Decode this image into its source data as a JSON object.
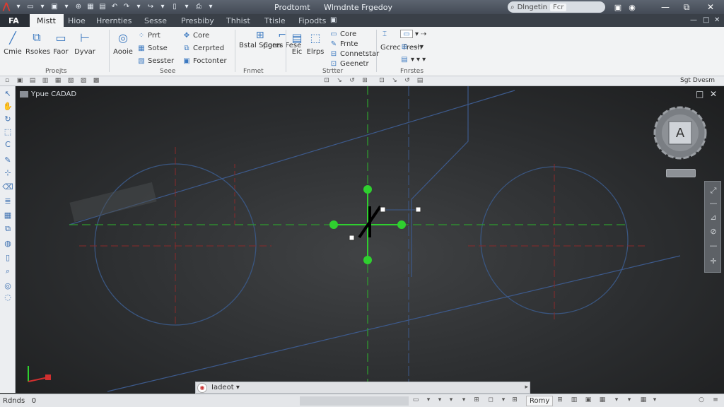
{
  "app": {
    "title_left": "Prodtomt",
    "title_right": "Wlmdnte Frgedoy",
    "search_value": "Dlngetin",
    "search_box": "Fcr"
  },
  "menu": {
    "file": "FA",
    "tabs": [
      "Mistt",
      "Hioe",
      "Hrernties",
      "Sesse",
      "Presbiby",
      "Thhist",
      "Ttisle",
      "Fipodts"
    ]
  },
  "ribbon": {
    "large_buttons": [
      {
        "label": "Cmie"
      },
      {
        "label": "Rsokes"
      },
      {
        "label": "Faor"
      },
      {
        "label": "Dyvar"
      },
      {
        "label": "Aooie"
      },
      {
        "label": "Eic"
      },
      {
        "label": "Elrps"
      }
    ],
    "small_buttons": {
      "draw": [
        "Prrt",
        "Sotse",
        "Sesster"
      ],
      "modify": [
        "Core",
        "Cerprted",
        "Foctonter"
      ],
      "format": [
        "Bstal Spgen",
        "Cores Fese"
      ],
      "insert": [
        "Core",
        "Frnte",
        "Connetstar",
        "Geenetr"
      ],
      "layers": [
        "Gcrec Fresh"
      ]
    },
    "panel_titles": [
      "Proejts",
      "Seee",
      "Fnmet",
      "Strtter",
      "Fnrstes"
    ]
  },
  "subbar": {
    "right_label": "Sgt Dvesm"
  },
  "canvas": {
    "title": "Ypue CADAD"
  },
  "viewcube": {
    "face": "A"
  },
  "command": {
    "text": "Iadeot",
    "dropdown": "▾"
  },
  "status": {
    "left": "Rdnds",
    "left_suffix": "0",
    "zoom": "Romy"
  },
  "colors": {
    "accent": "#3a78c0",
    "grip_green": "#2fd02f",
    "drawing_blue": "#3d5a8c",
    "center_red": "#a03030"
  },
  "icons": {
    "logo": "app-logo-icon",
    "viewcube": "viewcube-icon"
  }
}
